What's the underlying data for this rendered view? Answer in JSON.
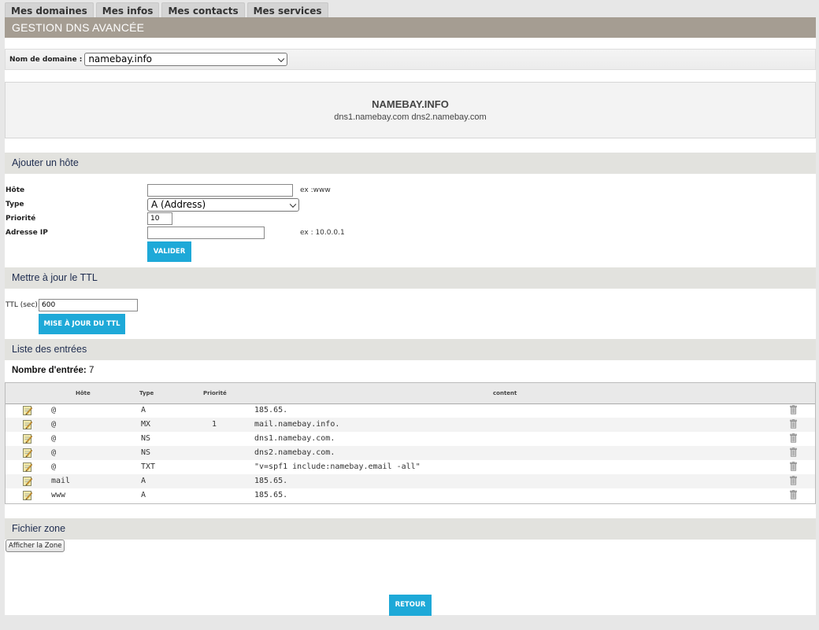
{
  "tabs": [
    "Mes domaines",
    "Mes infos",
    "Mes contacts",
    "Mes services"
  ],
  "header": {
    "title": "GESTION DNS AVANCÉE"
  },
  "domain_selector": {
    "label": "Nom de domaine :",
    "selected": "namebay.info"
  },
  "domain_card": {
    "name": "NAMEBAY.INFO",
    "nameservers": "dns1.namebay.com dns2.namebay.com"
  },
  "add_host": {
    "title": "Ajouter un hôte",
    "host_label": "Hôte",
    "host_value": "",
    "host_hint": "ex :www",
    "type_label": "Type",
    "type_value": "A (Address)",
    "priority_label": "Priorité",
    "priority_value": "10",
    "ip_label": "Adresse IP",
    "ip_value": "",
    "ip_hint": "ex : 10.0.0.1",
    "submit_label": "VALIDER"
  },
  "ttl": {
    "title": "Mettre à jour le TTL",
    "label": "TTL (sec):",
    "value": "600",
    "submit_label": "MISE À JOUR DU TTL"
  },
  "entries": {
    "title": "Liste des entrées",
    "count_label": "Nombre d'entrée:",
    "count": "7",
    "columns": {
      "host": "Hôte",
      "type": "Type",
      "priority": "Priorité",
      "content": "content"
    },
    "rows": [
      {
        "host": "@",
        "type": "A",
        "priority": "",
        "content": "185.65."
      },
      {
        "host": "@",
        "type": "MX",
        "priority": "1",
        "content": "mail.namebay.info."
      },
      {
        "host": "@",
        "type": "NS",
        "priority": "",
        "content": "dns1.namebay.com."
      },
      {
        "host": "@",
        "type": "NS",
        "priority": "",
        "content": "dns2.namebay.com."
      },
      {
        "host": "@",
        "type": "TXT",
        "priority": "",
        "content": "\"v=spf1 include:namebay.email -all\""
      },
      {
        "host": "mail",
        "type": "A",
        "priority": "",
        "content": "185.65."
      },
      {
        "host": "www",
        "type": "A",
        "priority": "",
        "content": "185.65."
      }
    ]
  },
  "zone": {
    "title": "Fichier zone",
    "show_label": "Afficher la Zone"
  },
  "back_label": "RETOUR",
  "colors": {
    "header_bg": "#a59d92",
    "section_bg": "#e2e2de",
    "button_blue": "#1ea9d8",
    "section_text": "#1e2c4f"
  },
  "icons": {
    "edit": "edit-note-icon",
    "delete": "trash-icon",
    "dropdown": "chevron-down-icon"
  }
}
